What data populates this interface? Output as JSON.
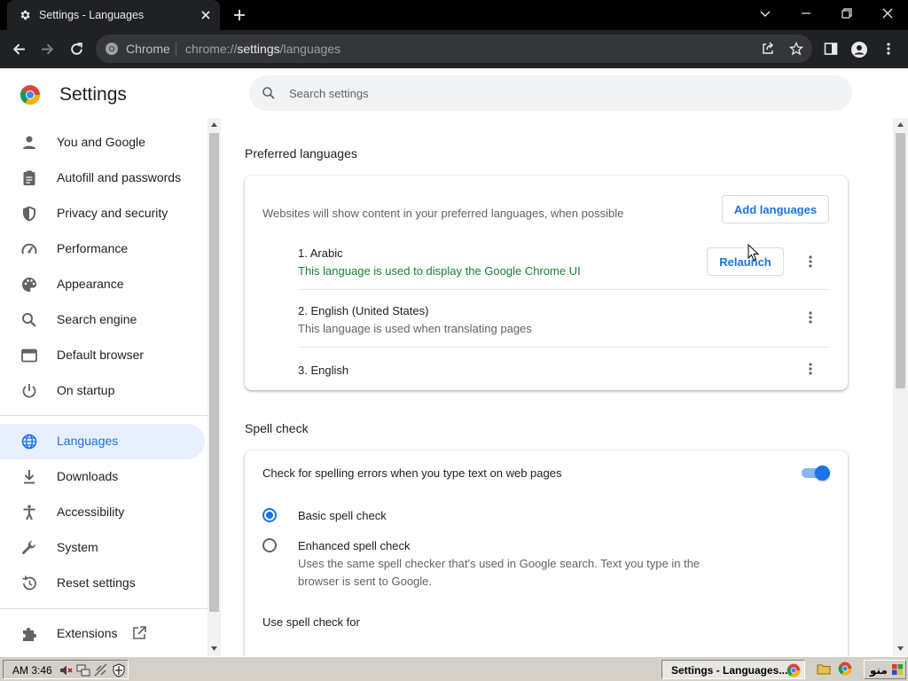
{
  "tab": {
    "title": "Settings - Languages"
  },
  "toolbar": {
    "site_chip": "Chrome",
    "url_scheme": "chrome://",
    "url_host": "settings",
    "url_path": "/languages"
  },
  "header": {
    "title": "Settings",
    "search_placeholder": "Search settings"
  },
  "sidebar": {
    "items": [
      {
        "label": "You and Google",
        "icon": "person-icon"
      },
      {
        "label": "Autofill and passwords",
        "icon": "clipboard-icon"
      },
      {
        "label": "Privacy and security",
        "icon": "shield-icon"
      },
      {
        "label": "Performance",
        "icon": "speedometer-icon"
      },
      {
        "label": "Appearance",
        "icon": "palette-icon"
      },
      {
        "label": "Search engine",
        "icon": "search-icon"
      },
      {
        "label": "Default browser",
        "icon": "browser-window-icon"
      },
      {
        "label": "On startup",
        "icon": "power-icon"
      },
      {
        "label": "Languages",
        "icon": "globe-icon",
        "active": true
      },
      {
        "label": "Downloads",
        "icon": "download-icon"
      },
      {
        "label": "Accessibility",
        "icon": "accessibility-icon"
      },
      {
        "label": "System",
        "icon": "wrench-icon"
      },
      {
        "label": "Reset settings",
        "icon": "reset-history-icon"
      },
      {
        "label": "Extensions",
        "icon": "puzzle-icon"
      }
    ]
  },
  "preferred_languages": {
    "title": "Preferred languages",
    "description": "Websites will show content in your preferred languages, when possible",
    "add_button": "Add languages",
    "languages": [
      {
        "name": "1. Arabic",
        "sub": "This language is used to display the Google Chrome UI",
        "action": "Relaunch"
      },
      {
        "name": "2. English (United States)",
        "sub": "This language is used when translating pages"
      },
      {
        "name": "3. English"
      }
    ]
  },
  "spell_check": {
    "title": "Spell check",
    "toggle_label": "Check for spelling errors when you type text on web pages",
    "toggle_on": true,
    "basic_label": "Basic spell check",
    "enhanced_label": "Enhanced spell check",
    "enhanced_desc_line1": "Uses the same spell checker that's used in Google search. Text you type in the",
    "enhanced_desc_line2": "browser is sent to Google.",
    "use_for": "Use spell check for",
    "selected": "basic"
  },
  "colors": {
    "accent": "#1a73e8",
    "ui_language_note": "#188038",
    "active_nav_bg": "#e8f0fe"
  },
  "taskbar": {
    "clock": "AM 3:46",
    "task_label": "Settings - Languages...",
    "start_label": "منو"
  }
}
